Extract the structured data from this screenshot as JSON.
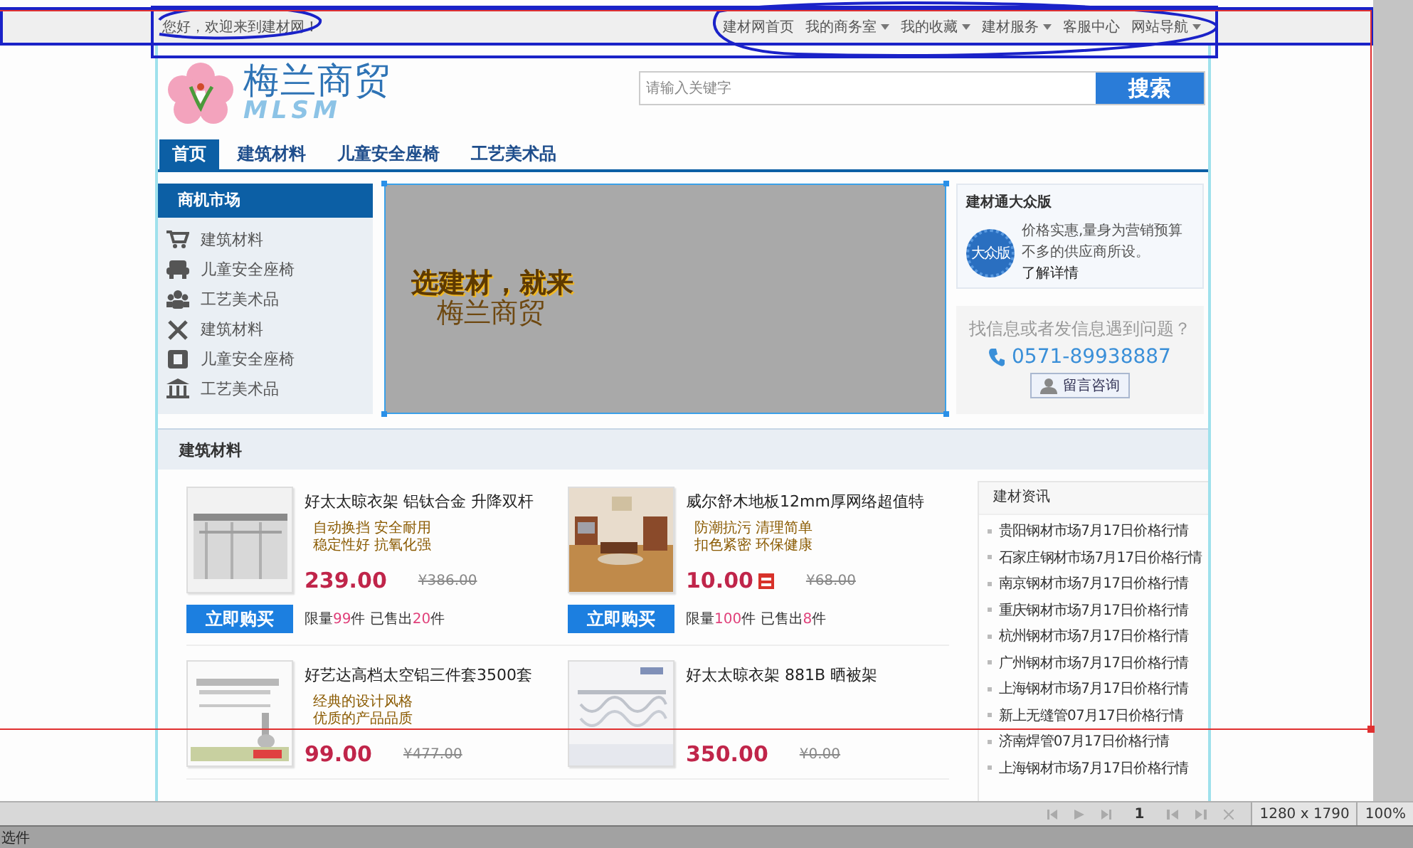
{
  "top_bar": {
    "greeting": "您好，欢迎来到建材网！",
    "links": [
      {
        "label": "建材网首页",
        "dropdown": false
      },
      {
        "label": "我的商务室",
        "dropdown": true
      },
      {
        "label": "我的收藏",
        "dropdown": true
      },
      {
        "label": "建材服务",
        "dropdown": true
      },
      {
        "label": "客服中心",
        "dropdown": false
      },
      {
        "label": "网站导航",
        "dropdown": true
      }
    ]
  },
  "header": {
    "logo_text": "梅兰商贸",
    "logo_subtext": "MLSM",
    "search": {
      "placeholder": "请输入关键字",
      "button": "搜索"
    }
  },
  "nav": [
    {
      "label": "首页",
      "selected": true
    },
    {
      "label": "建筑材料",
      "selected": false
    },
    {
      "label": "儿童安全座椅",
      "selected": false
    },
    {
      "label": "工艺美术品",
      "selected": false
    }
  ],
  "sidebar": {
    "title": "商机市场",
    "items": [
      {
        "label": "建筑材料",
        "kind": "cart"
      },
      {
        "label": "儿童安全座椅",
        "kind": "seat"
      },
      {
        "label": "工艺美术品",
        "kind": "people"
      },
      {
        "label": "建筑材料",
        "kind": "tools"
      },
      {
        "label": "儿童安全座椅",
        "kind": "square"
      },
      {
        "label": "工艺美术品",
        "kind": "bank"
      }
    ]
  },
  "banner": {
    "line_1": "选建材，就来",
    "line_2": "梅兰商贸"
  },
  "promo": {
    "title": "建材通大众版",
    "badge": "大众版",
    "text": "价格实惠,量身为营销预算不多的供应商所设。",
    "link": "了解详情"
  },
  "help": {
    "question": "找信息或者发信息遇到问题？",
    "phone": "0571-89938887",
    "button": "留言咨询"
  },
  "section_title": "建筑材料",
  "products": [
    {
      "title": "好太太晾衣架 铝钛合金 升降双杆",
      "features": [
        "自动换挡 安全耐用",
        "稳定性好 抗氧化强"
      ],
      "price": "239.00",
      "discount_tag": false,
      "old_price": "¥386.00",
      "buy_button": "立即购买",
      "stock": [
        "限量",
        "99",
        "件 已售出",
        "20",
        "件"
      ]
    },
    {
      "title": "威尔舒木地板12mm厚网络超值特",
      "features": [
        "防潮抗污 清理简单",
        "扣色紧密 环保健康"
      ],
      "price": "10.00",
      "discount_tag": true,
      "old_price": "¥68.00",
      "buy_button": "立即购买",
      "stock": [
        "限量",
        "100",
        "件 已售出",
        "8",
        "件"
      ]
    },
    {
      "title": "好艺达高档太空铝三件套3500套",
      "features": [
        "经典的设计风格",
        "优质的产品品质"
      ],
      "price": "99.00",
      "discount_tag": false,
      "old_price": "¥477.00"
    },
    {
      "title": "好太太晾衣架 881B 晒被架",
      "price": "350.00",
      "discount_tag": false,
      "old_price": "¥0.00"
    }
  ],
  "news": {
    "title": "建材资讯",
    "items": [
      "贵阳钢材市场7月17日价格行情",
      "石家庄钢材市场7月17日价格行情",
      "南京钢材市场7月17日价格行情",
      "重庆钢材市场7月17日价格行情",
      "杭州钢材市场7月17日价格行情",
      "广州钢材市场7月17日价格行情",
      "上海钢材市场7月17日价格行情",
      "新上无缝管07月17日价格行情",
      "济南焊管07月17日价格行情",
      "上海钢材市场7月17日价格行情"
    ]
  },
  "status_bar": {
    "page": "1",
    "canvas_size": "1280 x 1790",
    "zoom": "100%",
    "panel_tab": "选件"
  }
}
